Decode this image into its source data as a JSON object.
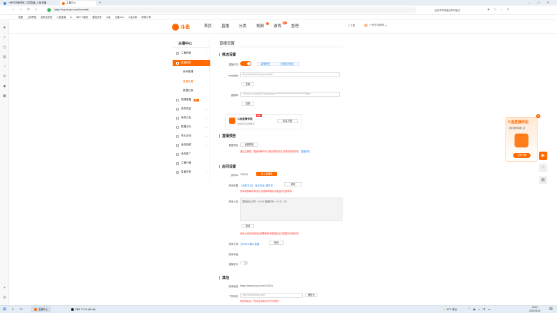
{
  "browser": {
    "tabs": [
      {
        "label": "一杯可乐解渴系 力顶直播_斗鱼直播",
        "favicon_color": "#ff6a00"
      },
      {
        "label": "主播中心",
        "favicon_color": "#ff6a00"
      }
    ],
    "new_tab": "+",
    "url": "https://mp.douyu.com/live/main",
    "search_hint": "北京市商场营业时间官方",
    "bookmarks": [
      "收藏",
      "上网导航",
      "我常去的站",
      "斗鱼直播",
      "tv",
      "每个人都说",
      "微信文件",
      "斗鱼",
      "主播Hub",
      "斗鱼分析",
      "网络订单"
    ]
  },
  "header": {
    "logo_text": "斗鱼",
    "nav": [
      {
        "label": "首页",
        "badge": ""
      },
      {
        "label": "直播",
        "badge": ""
      },
      {
        "label": "分类",
        "badge": ""
      },
      {
        "label": "视频",
        "badge": "1"
      },
      {
        "label": "游戏",
        "badge": "DY"
      },
      {
        "label": "鱼吧",
        "badge": ""
      }
    ],
    "download": "下载",
    "username": "一杯可乐解渴"
  },
  "sidebar": {
    "title": "主播中心",
    "items": [
      {
        "label": "主播档案",
        "active": false
      },
      {
        "label": "直播相关",
        "active": true
      },
      {
        "label": "视频直播",
        "active": false,
        "hot": "热门"
      },
      {
        "label": "我的收益",
        "active": false
      },
      {
        "label": "我的公会",
        "active": false
      },
      {
        "label": "数据分析",
        "active": false
      },
      {
        "label": "商业活动",
        "active": false
      },
      {
        "label": "我的视频",
        "active": false
      },
      {
        "label": "我的推广",
        "active": false
      },
      {
        "label": "主播兴趣",
        "active": false
      },
      {
        "label": "直播学堂",
        "active": false
      }
    ],
    "subitems": [
      {
        "label": "房间管理",
        "current": false
      },
      {
        "label": "直播设置",
        "current": true
      },
      {
        "label": "数据记录",
        "current": false
      }
    ]
  },
  "main": {
    "title": "直播设置",
    "push": {
      "section": "推流设置",
      "switch_label": "直播开关:",
      "switch_on": true,
      "tag1": "直播教程",
      "tag2": "切换推流地址",
      "rtmp_label": "rtmp地址:",
      "rtmp_value": "rtmp://sendtc3.douyu.com/live",
      "copy1": "复制",
      "code_label": "直播码:",
      "code_value": "762291rCXOhN1DF?wsSecret=**********************************Ree?",
      "copy2": "复制",
      "promo_title": "斗鱼直播伴侣",
      "promo_sub": "加载最佳画质推流",
      "promo_badge": "推荐",
      "promo_btn": "前往下载"
    },
    "notice": {
      "section": "直播预告",
      "label": "直播预告:",
      "btn": "设置预告",
      "warn": "通过主播端、直播间等均可以展示预告内容,请遵守相关规则",
      "link": "直播规则"
    },
    "room": {
      "section": "房间设置",
      "id_label": "房间ID:",
      "id_value": "762291",
      "id_btn": "进入直播间",
      "title_label": "房间标题:",
      "title_value": "【深夜不见】 每天在线, 随时到",
      "title_btn": "修改",
      "title_warn": "房间标题每次修改后,将重新审核后才能显示在房间内",
      "notice_label": "房间公告:",
      "notice_value": "直播间QQ 群：XXXX  直播时间：19:12 - 22:",
      "notice_btn": "修改",
      "notice_warn": "房间公告每次修改后需要审核,审核通过后才能展示在房间内",
      "category_label": "房间分类:",
      "category_value": "无/others娱乐直播",
      "category_btn": "修改",
      "cover_label": "房间封面:",
      "music_label": "直播音乐:",
      "music_on": false
    },
    "other": {
      "section": "其他",
      "share_label": "房间链接:",
      "share_value": "https://www.douyu.com/762291",
      "addr_label": "个性域名:",
      "addr_value": "http://www.douyu.com/",
      "addr_btn": "确定",
      "addr_warn": "修改域名后,个性域名将60天内不可修改"
    }
  },
  "promo_float": {
    "title": "斗鱼直播伴侣",
    "sub": "最好用的直播工具",
    "btn": "立即下载"
  },
  "taskbar": {
    "apps": [
      "主播中心",
      "OBS 27.0.1 (64-bit)"
    ],
    "weather": "11°C 多云",
    "time": "20:51",
    "date": "2021/11/24"
  }
}
